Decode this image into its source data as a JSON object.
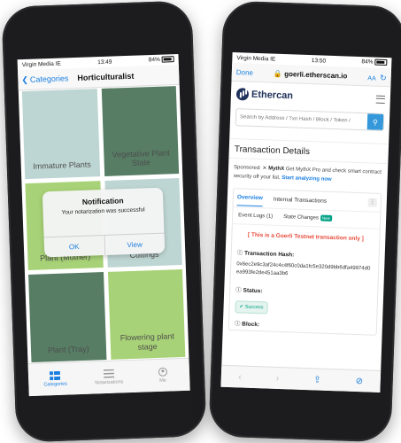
{
  "left_phone": {
    "status": {
      "carrier": "Virgin Media IE",
      "time": "13:49",
      "battery": "84%"
    },
    "nav": {
      "back_label": "Categories",
      "title": "Horticulturalist"
    },
    "tiles": [
      {
        "label": "Immature Plants"
      },
      {
        "label": "Vegetative Plant State"
      },
      {
        "label": "Plant (Mother)"
      },
      {
        "label": "Cuttings"
      },
      {
        "label": "Plant (Tray)"
      },
      {
        "label": "Flowering plant stage"
      }
    ],
    "alert": {
      "title": "Notification",
      "message": "Your notarization was successful",
      "ok_label": "OK",
      "view_label": "View"
    },
    "tabbar": [
      {
        "label": "Categories",
        "icon": "grid-icon"
      },
      {
        "label": "Notarizations",
        "icon": "list-icon"
      },
      {
        "label": "Me",
        "icon": "person-icon"
      }
    ]
  },
  "right_phone": {
    "status": {
      "carrier": "Virgin Media IE",
      "time": "13:50",
      "battery": "84%"
    },
    "browser": {
      "done_label": "Done",
      "url": "goerli.etherscan.io",
      "aa_label": "AA"
    },
    "site": {
      "brand": "Ethercan"
    },
    "search": {
      "placeholder": "Search by Address / Txn Hash / Block / Token /"
    },
    "page_title": "Transaction Details",
    "sponsored": {
      "prefix": "Sponsored:",
      "brand": "MythX",
      "text": "Get MythX Pro and check smart contract security off your list.",
      "link": "Start analyzing now"
    },
    "tabs": {
      "overview": "Overview",
      "internal": "Internal Transactions"
    },
    "subtabs": {
      "event_logs": "Event Logs (1)",
      "state_changes": "State Changes",
      "badge": "New"
    },
    "warning": "[ This is a Goerli Testnet transaction only ]",
    "hash_label": "Transaction Hash:",
    "hash_value": "0x6ec2e9c3af24c4c4f60c0da1fc5e320d9bb6dfa49974d0ea993fe2de451aa3b6",
    "status_label": "Status:",
    "status_value": "Success",
    "block_label": "Block:"
  }
}
